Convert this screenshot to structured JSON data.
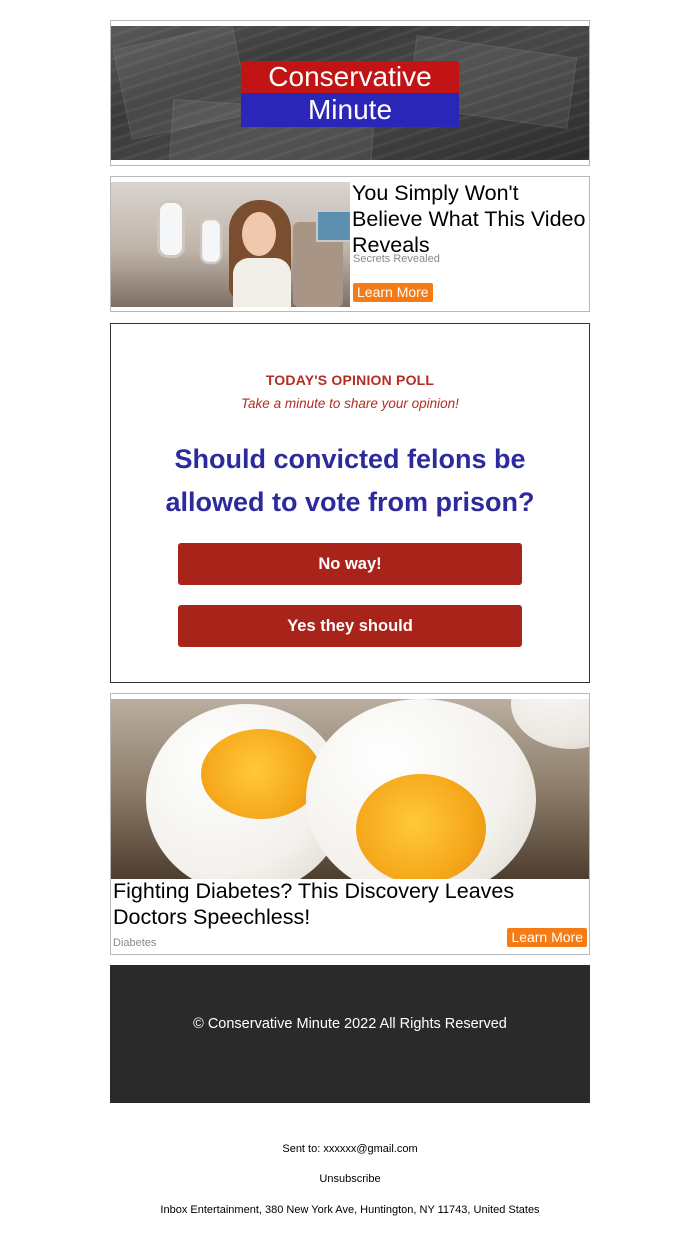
{
  "header": {
    "logo_line1": "Conservative",
    "logo_line2": "Minute"
  },
  "ad1": {
    "title": "You Simply Won't Believe What This Video Reveals",
    "category": "Secrets Revealed",
    "button": "Learn More"
  },
  "poll": {
    "kicker": "TODAY'S OPINION POLL",
    "subtitle": "Take a minute to share your opinion!",
    "question": "Should convicted felons be allowed to vote from prison?",
    "option_no": "No way!",
    "option_yes": "Yes they should"
  },
  "ad2": {
    "title": "Fighting Diabetes? This Discovery Leaves Doctors Speechless!",
    "category": "Diabetes",
    "button": "Learn More"
  },
  "footer": {
    "copyright": "© Conservative Minute 2022 All Rights Reserved",
    "sent_to": "Sent to: xxxxxx@gmail.com",
    "unsubscribe": "Unsubscribe",
    "address": "Inbox Entertainment, 380 New York Ave, Huntington, NY 11743, United States"
  },
  "colors": {
    "logo_red": "#c21414",
    "logo_blue": "#2a27b8",
    "poll_red": "#b42d23",
    "poll_blue": "#2c2a9c",
    "button_red": "#a8241b",
    "learn_orange": "#f47b15",
    "footer_bg": "#2a2a2a"
  }
}
